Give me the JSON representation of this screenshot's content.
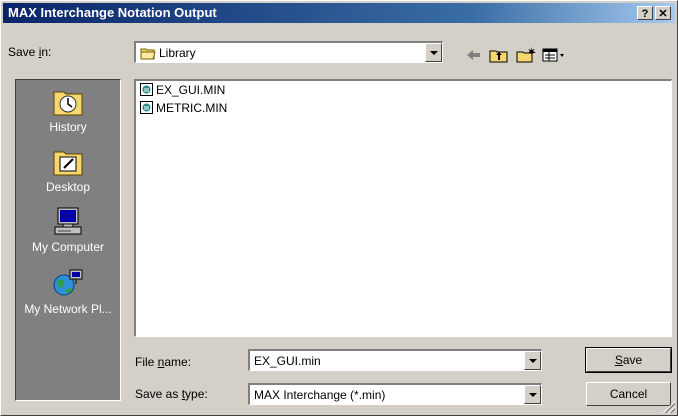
{
  "window": {
    "title": "MAX Interchange Notation Output",
    "help_label": "?",
    "close_label": "✕"
  },
  "save_in": {
    "label_prefix": "Save ",
    "label_access": "i",
    "label_suffix": "n:",
    "value": "Library"
  },
  "places": [
    {
      "label": "History",
      "icon": "history-icon"
    },
    {
      "label": "Desktop",
      "icon": "desktop-icon"
    },
    {
      "label": "My Computer",
      "icon": "my-computer-icon"
    },
    {
      "label": "My Network Pl...",
      "icon": "network-places-icon"
    }
  ],
  "files": [
    {
      "name": "EX_GUI.MIN"
    },
    {
      "name": "METRIC.MIN"
    }
  ],
  "file_name": {
    "label_prefix": "File ",
    "label_access": "n",
    "label_suffix": "ame:",
    "value": "EX_GUI.min"
  },
  "save_as_type": {
    "label_prefix": "Save as ",
    "label_access": "t",
    "label_suffix": "ype:",
    "value": "MAX Interchange (*.min)"
  },
  "buttons": {
    "save_access": "S",
    "save_rest": "ave",
    "cancel": "Cancel"
  }
}
